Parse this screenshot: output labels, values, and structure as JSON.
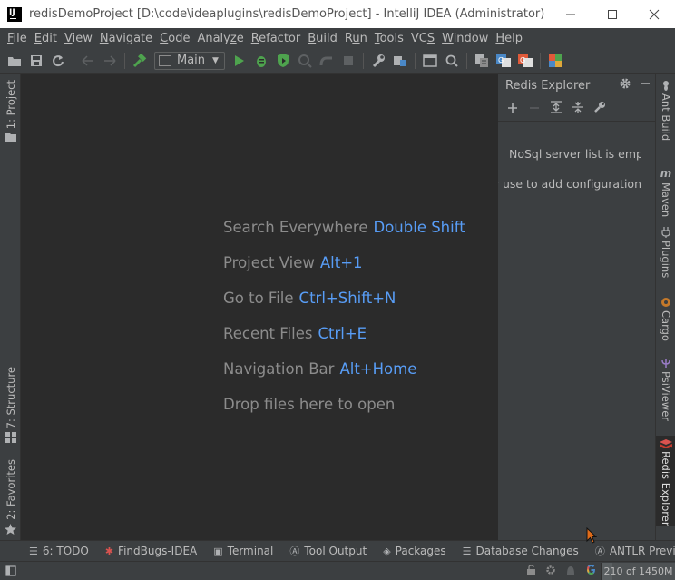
{
  "window": {
    "title": "redisDemoProject [D:\\code\\ideaplugins\\redisDemoProject] - IntelliJ IDEA (Administrator)",
    "controls": [
      "—",
      "☐",
      "✕"
    ]
  },
  "menu": [
    {
      "mn": "F",
      "rest": "ile"
    },
    {
      "mn": "E",
      "rest": "dit"
    },
    {
      "mn": "V",
      "rest": "iew"
    },
    {
      "mn": "N",
      "rest": "avigate"
    },
    {
      "mn": "C",
      "rest": "ode"
    },
    {
      "pre": "Analy",
      "mn": "z",
      "rest": "e"
    },
    {
      "mn": "R",
      "rest": "efactor"
    },
    {
      "mn": "B",
      "rest": "uild"
    },
    {
      "pre": "R",
      "mn": "u",
      "rest": "n"
    },
    {
      "mn": "T",
      "rest": "ools"
    },
    {
      "pre": "VC",
      "mn": "S",
      "rest": ""
    },
    {
      "mn": "W",
      "rest": "indow"
    },
    {
      "mn": "H",
      "rest": "elp"
    }
  ],
  "toolbar": {
    "run_config": "Main"
  },
  "left_tabs": {
    "project": "1: Project",
    "structure": "7: Structure",
    "favorites": "2: Favorites"
  },
  "editor": {
    "hints": [
      {
        "label": "Search Everywhere",
        "key": "Double Shift"
      },
      {
        "label": "Project View",
        "key": "Alt+1"
      },
      {
        "label": "Go to File",
        "key": "Ctrl+Shift+N"
      },
      {
        "label": "Recent Files",
        "key": "Ctrl+E"
      },
      {
        "label": "Navigation Bar",
        "key": "Alt+Home"
      },
      {
        "label": "Drop files here to open",
        "key": ""
      }
    ]
  },
  "redis_explorer": {
    "title": "Redis Explorer",
    "empty_line1": "NoSql server list is empty",
    "empty_line2": "You may use  to add configuration"
  },
  "right_tabs": {
    "ant": "Ant Build",
    "maven": "Maven",
    "plugins": "Plugins",
    "cargo": "Cargo",
    "psiviewer": "PsiViewer",
    "redis": "Redis Explorer"
  },
  "bottom_tools": [
    {
      "icon": "list-icon",
      "glyph": "☰",
      "label": "6: TODO",
      "mn": "6"
    },
    {
      "icon": "bug-icon",
      "glyph": "✱",
      "label": "FindBugs-IDEA"
    },
    {
      "icon": "terminal-icon",
      "glyph": "▣",
      "label": "Terminal"
    },
    {
      "icon": "antlr-icon",
      "glyph": "Ⓐ",
      "label": "Tool Output"
    },
    {
      "icon": "packages-icon",
      "glyph": "◈",
      "label": "Packages"
    },
    {
      "icon": "database-icon",
      "glyph": "☰",
      "label": "Database Changes"
    },
    {
      "icon": "antlr-icon",
      "glyph": "Ⓐ",
      "label": "ANTLR Preview"
    }
  ],
  "status": {
    "memory": "210 of 1450M",
    "memory_used_fraction": 0.145
  },
  "colors": {
    "accent_key": "#589df6",
    "editor_bg": "#2b2b2b",
    "panel_bg": "#3c3f41"
  }
}
